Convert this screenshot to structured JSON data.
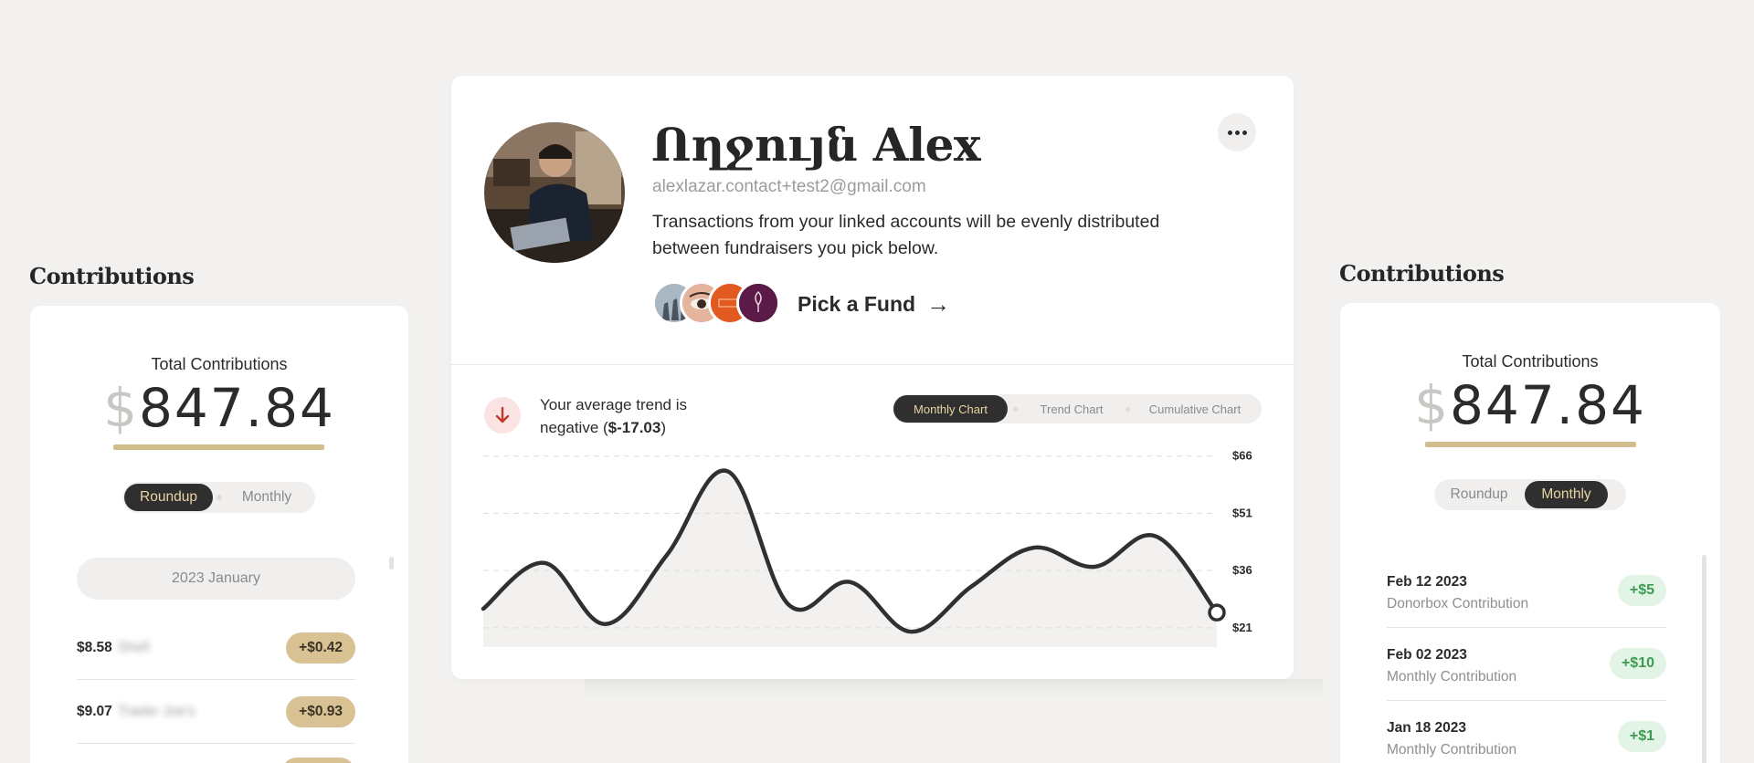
{
  "left_panel": {
    "title": "Contributions",
    "total_label": "Total Contributions",
    "currency_symbol": "$",
    "total_amount": "847.84",
    "toggle": {
      "options": [
        "Roundup",
        "Monthly"
      ],
      "selected": "Roundup"
    },
    "month_header": "2023 January",
    "transactions": [
      {
        "amount": "$8.58",
        "merchant": "Shell",
        "roundup": "+$0.42"
      },
      {
        "amount": "$9.07",
        "merchant": "Trader Joe's",
        "roundup": "+$0.93"
      }
    ]
  },
  "profile": {
    "name": "Ողջույն Alex",
    "email": "alexlazar.contact+test2@gmail.com",
    "description": "Transactions from your linked accounts will be evenly distributed between fundraisers you pick below.",
    "pick_fund_label": "Pick a Fund",
    "pick_fund_arrow": "→",
    "more_icon": "more-horizontal-icon"
  },
  "trend": {
    "text_prefix": "Your average trend is negative (",
    "value": "$-17.03",
    "text_suffix": ")",
    "icon": "arrow-down-icon",
    "icon_color": "#c0392b"
  },
  "chart_tabs": {
    "options": [
      "Monthly Chart",
      "Trend Chart",
      "Cumulative Chart"
    ],
    "selected": "Monthly Chart"
  },
  "chart_data": {
    "type": "area",
    "y_tick_labels": [
      "$66",
      "$51",
      "$36",
      "$21"
    ],
    "y_ticks": [
      66,
      51,
      36,
      21
    ],
    "ylim": [
      15,
      70
    ],
    "grid": true,
    "values": [
      26,
      38,
      22,
      40,
      62,
      27,
      33,
      20,
      32,
      42,
      37,
      45,
      25
    ],
    "line_color": "#303030",
    "fill_color": "#f2f1ef"
  },
  "right_panel": {
    "title": "Contributions",
    "total_label": "Total Contributions",
    "currency_symbol": "$",
    "total_amount": "847.84",
    "toggle": {
      "options": [
        "Roundup",
        "Monthly"
      ],
      "selected": "Monthly"
    },
    "contributions": [
      {
        "date": "Feb 12 2023",
        "description": "Donorbox Contribution",
        "amount": "+$5"
      },
      {
        "date": "Feb 02 2023",
        "description": "Monthly Contribution",
        "amount": "+$10"
      },
      {
        "date": "Jan 18 2023",
        "description": "Monthly Contribution",
        "amount": "+$1"
      }
    ]
  },
  "colors": {
    "accent_gold": "#d2bd8c",
    "dark": "#2e2f2e",
    "positive_green": "#3e9a53",
    "negative_red": "#c0392b"
  }
}
